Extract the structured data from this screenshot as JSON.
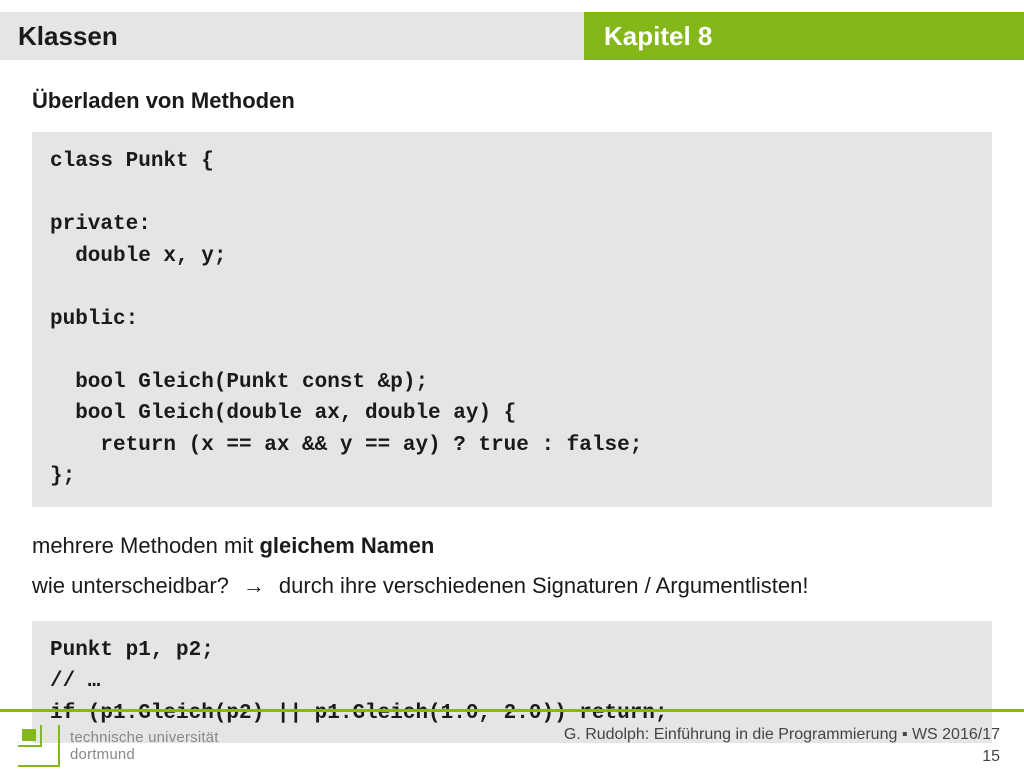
{
  "header": {
    "left": "Klassen",
    "right": "Kapitel 8"
  },
  "subtitle": "Überladen von Methoden",
  "code1": "class Punkt {\n\nprivate:\n  double x, y;\n\npublic:\n\n  bool Gleich(Punkt const &p);\n  bool Gleich(double ax, double ay) {\n    return (x == ax && y == ay) ? true : false;\n};",
  "line1_a": "mehrere Methoden mit ",
  "line1_b": "gleichem Namen",
  "line2_a": "wie unterscheidbar?",
  "line2_arrow": "→",
  "line2_b": "durch ihre verschiedenen Signaturen / Argumentlisten!",
  "code2": "Punkt p1, p2;\n// …\nif (p1.Gleich(p2) || p1.Gleich(1.0, 2.0)) return;",
  "footer": {
    "uni_line1": "technische universität",
    "uni_line2": "dortmund",
    "meta_line1": "G. Rudolph: Einführung in die Programmierung ▪ WS 2016/17",
    "meta_line2": "15"
  }
}
